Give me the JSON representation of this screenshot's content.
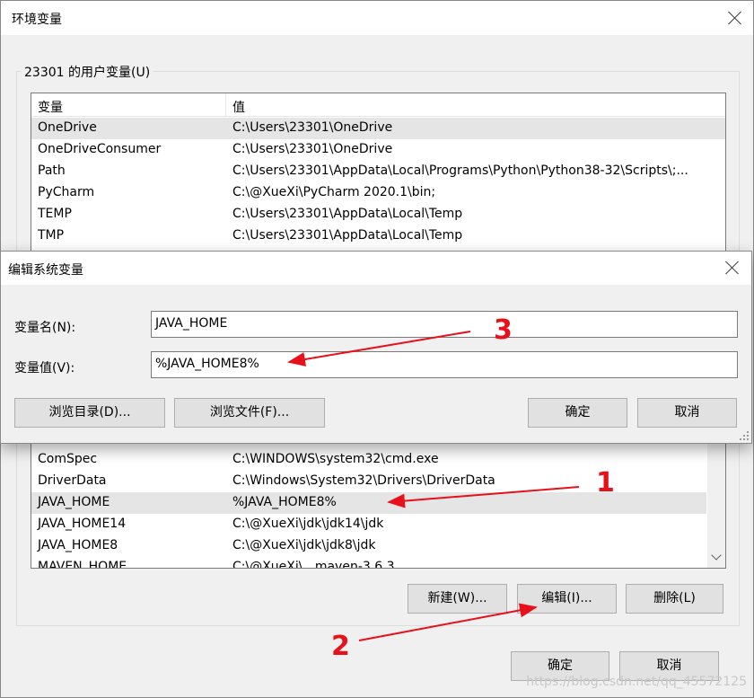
{
  "env_window": {
    "title": "环境变量",
    "user_group_label": "23301 的用户变量(U)",
    "user_columns": [
      "变量",
      "值"
    ],
    "user_rows": [
      {
        "name": "OneDrive",
        "value": "C:\\Users\\23301\\OneDrive"
      },
      {
        "name": "OneDriveConsumer",
        "value": "C:\\Users\\23301\\OneDrive"
      },
      {
        "name": "Path",
        "value": "C:\\Users\\23301\\AppData\\Local\\Programs\\Python\\Python38-32\\Scripts\\;..."
      },
      {
        "name": "PyCharm",
        "value": "C:\\@XueXi\\PyCharm 2020.1\\bin;"
      },
      {
        "name": "TEMP",
        "value": "C:\\Users\\23301\\AppData\\Local\\Temp"
      },
      {
        "name": "TMP",
        "value": "C:\\Users\\23301\\AppData\\Local\\Temp"
      }
    ],
    "system_rows": [
      {
        "name": "ComSpec",
        "value": "C:\\WINDOWS\\system32\\cmd.exe"
      },
      {
        "name": "DriverData",
        "value": "C:\\Windows\\System32\\Drivers\\DriverData"
      },
      {
        "name": "JAVA_HOME",
        "value": "%JAVA_HOME8%"
      },
      {
        "name": "JAVA_HOME14",
        "value": "C:\\@XueXi\\jdk\\jdk14\\jdk"
      },
      {
        "name": "JAVA_HOME8",
        "value": "C:\\@XueXi\\jdk\\jdk8\\jdk"
      },
      {
        "name": "MAVEN_HOME",
        "value": "C:\\@XueXi\\...maven-3.6.3"
      }
    ],
    "system_buttons": {
      "new": "新建(W)...",
      "edit": "编辑(I)...",
      "delete": "删除(L)"
    },
    "footer_buttons": {
      "ok": "确定",
      "cancel": "取消"
    }
  },
  "edit_dialog": {
    "title": "编辑系统变量",
    "name_label": "变量名(N):",
    "name_value": "JAVA_HOME",
    "value_label": "变量值(V):",
    "value_value": "%JAVA_HOME8%",
    "browse_dir": "浏览目录(D)...",
    "browse_file": "浏览文件(F)...",
    "ok": "确定",
    "cancel": "取消"
  },
  "annotations": {
    "n1": "1",
    "n2": "2",
    "n3": "3",
    "color": "#e8101a"
  },
  "watermark": "https://blog.csdn.net/qq_45572125"
}
